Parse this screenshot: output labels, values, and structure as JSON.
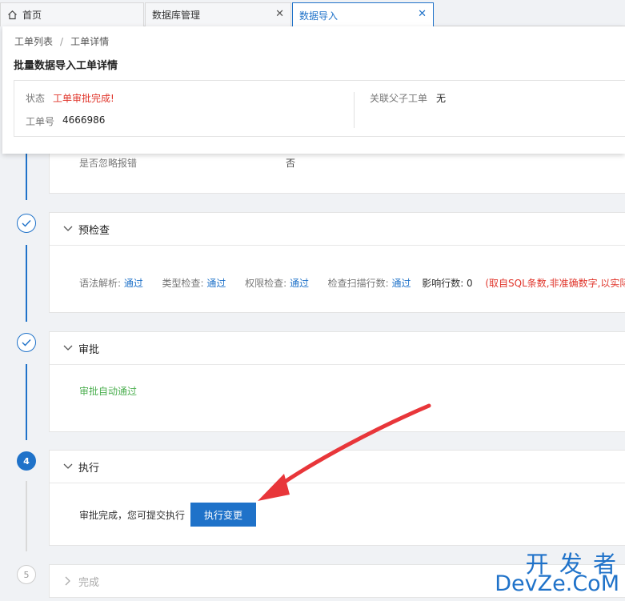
{
  "tabs": [
    {
      "label": "首页"
    },
    {
      "label": "数据库管理",
      "close": "✕"
    },
    {
      "label": "数据导入",
      "close": "✕"
    }
  ],
  "breadcrumb": {
    "item1": "工单列表",
    "sep": "/",
    "item2": "工单详情"
  },
  "page_title": "批量数据导入工单详情",
  "info": {
    "status_label": "状态",
    "status_value": "工单审批完成!",
    "order_label": "工单号",
    "order_value": "4666986",
    "related_label": "关联父子工单",
    "related_value": "无"
  },
  "step1": {
    "row_label": "是否忽略报错",
    "row_value": "否"
  },
  "step2": {
    "title": "预检查",
    "syntax_label": "语法解析:",
    "syntax_value": "通过",
    "type_label": "类型检查:",
    "type_value": "通过",
    "perm_label": "权限检查:",
    "perm_value": "通过",
    "scan_label": "检查扫描行数:",
    "scan_value": "通过",
    "affected": "影响行数: 0",
    "note": "(取自SQL条数,非准确数字,以实际执行"
  },
  "step3": {
    "title": "审批",
    "result": "审批自动通过"
  },
  "step4": {
    "number": "4",
    "title": "执行",
    "desc": "审批完成，您可提交执行",
    "button": "执行变更"
  },
  "step5": {
    "number": "5",
    "title": "完成"
  },
  "watermark": {
    "line1": "开 发 者",
    "line2": "DevZe.CoM"
  },
  "colors": {
    "accent": "#1f72c9",
    "success": "#4caf50",
    "danger": "#e0352b",
    "annotation_arrow": "#e8363a"
  }
}
